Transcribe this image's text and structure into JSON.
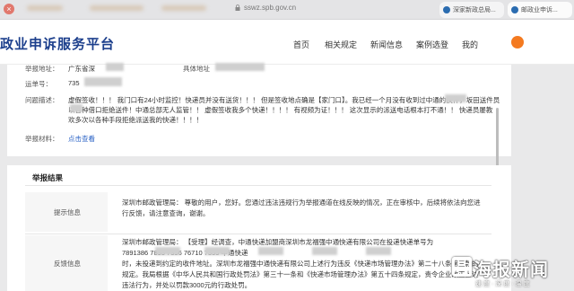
{
  "browser": {
    "url": "sswz.spb.gov.cn",
    "tabs": [
      {
        "label": "深家新政总局..."
      },
      {
        "label": "邮政业申诉..."
      }
    ]
  },
  "header": {
    "site_title": "政业申诉服务平台",
    "nav": [
      "首页",
      "相关规定",
      "新闻信息",
      "案例选登",
      "我的"
    ]
  },
  "report": {
    "location_label": "举报地址：",
    "location_value": "广东省深",
    "address_label": "具体地址",
    "waybill_label": "运单号：",
    "waybill_value": "735",
    "issue_label": "问题描述：",
    "issue_lines": [
      "虚假签收！！！ 我门口有24小时监控！快递员并没有送货！！！ 但是签收地点确是【家门口】。我已经一个月没有收到过中通的快件，坂田送件员",
      "以各种借口拒绝送件！中通总部无人监管！！ 虚假签收我多个快递！！！！ 有视频为证！！！ 这次显示的派送电话根本打不通！！ 快递员屡教",
      "欢多次以各种手段拒绝派送我的快递！！！！"
    ],
    "material_label": "举报材料：",
    "material_link": "点击查看"
  },
  "result": {
    "title": "举报结果",
    "rows": [
      {
        "label": "提示信息",
        "lines": [
          "深圳市邮政管理局：  尊敬的用户，您好。您通过违法违规行为举报通道在线反映的情况，正在审核中，后续将依法向您进",
          "行反馈，请注意查询，谢谢。"
        ]
      },
      {
        "label": "反馈信息",
        "lines": [
          "深圳市邮政管理局：  【受理】经调查，中通快递加盟商深圳市龙福强中通快递有限公司在投递快递单号为",
          "7891386       7893       7356       76710       7355       中通快递",
          "时，未投递到约定的收件地址。深圳市龙福强中通快递有限公司上述行为违反《快递市场管理办法》第二十八条第三款的",
          "规定。我局根据《中华人民共和国行政处罚法》第三十一条和《快递市场管理办法》第五十四条规定，责令企业改正上述",
          "违法行为，并处以罚款3000元的行政处罚。"
        ]
      }
    ]
  },
  "watermark": {
    "title": "海报新闻",
    "subtitle": "速度·深度·温度"
  },
  "colors": {
    "brand_blue": "#1c3f8c",
    "link_blue": "#2b63c6",
    "orange": "#f47a20"
  }
}
